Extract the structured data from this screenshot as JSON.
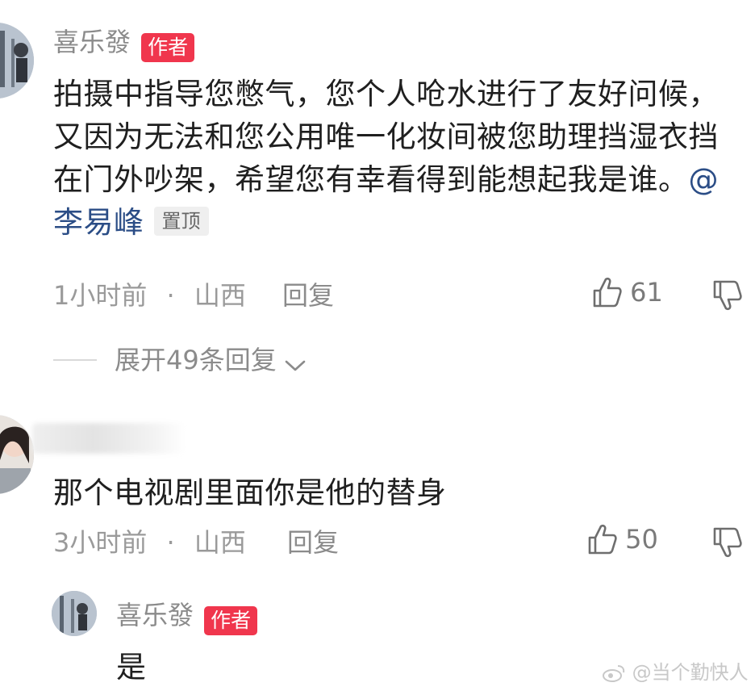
{
  "comments": [
    {
      "username": "喜乐發",
      "author_badge": "作者",
      "text": "拍摄中指导您憋气，您个人呛水进行了友好问候，又因为无法和您公用唯一化妆间被您助理挡湿衣挡在门外吵架，希望您有幸看得到能想起我是谁。",
      "mention": "@李易峰",
      "pinned_label": "置顶",
      "time": "1小时前",
      "location": "山西",
      "reply_label": "回复",
      "likes": "61",
      "expand_label": "展开49条回复"
    },
    {
      "text": "那个电视剧里面你是他的替身",
      "time": "3小时前",
      "location": "山西",
      "reply_label": "回复",
      "likes": "50"
    }
  ],
  "reply": {
    "username": "喜乐發",
    "author_badge": "作者",
    "text": "是"
  },
  "meta_separator": "·",
  "watermark": "@当个勤快人",
  "icons": [
    "like-icon",
    "dislike-icon",
    "chevron-down-icon",
    "weibo-icon"
  ]
}
